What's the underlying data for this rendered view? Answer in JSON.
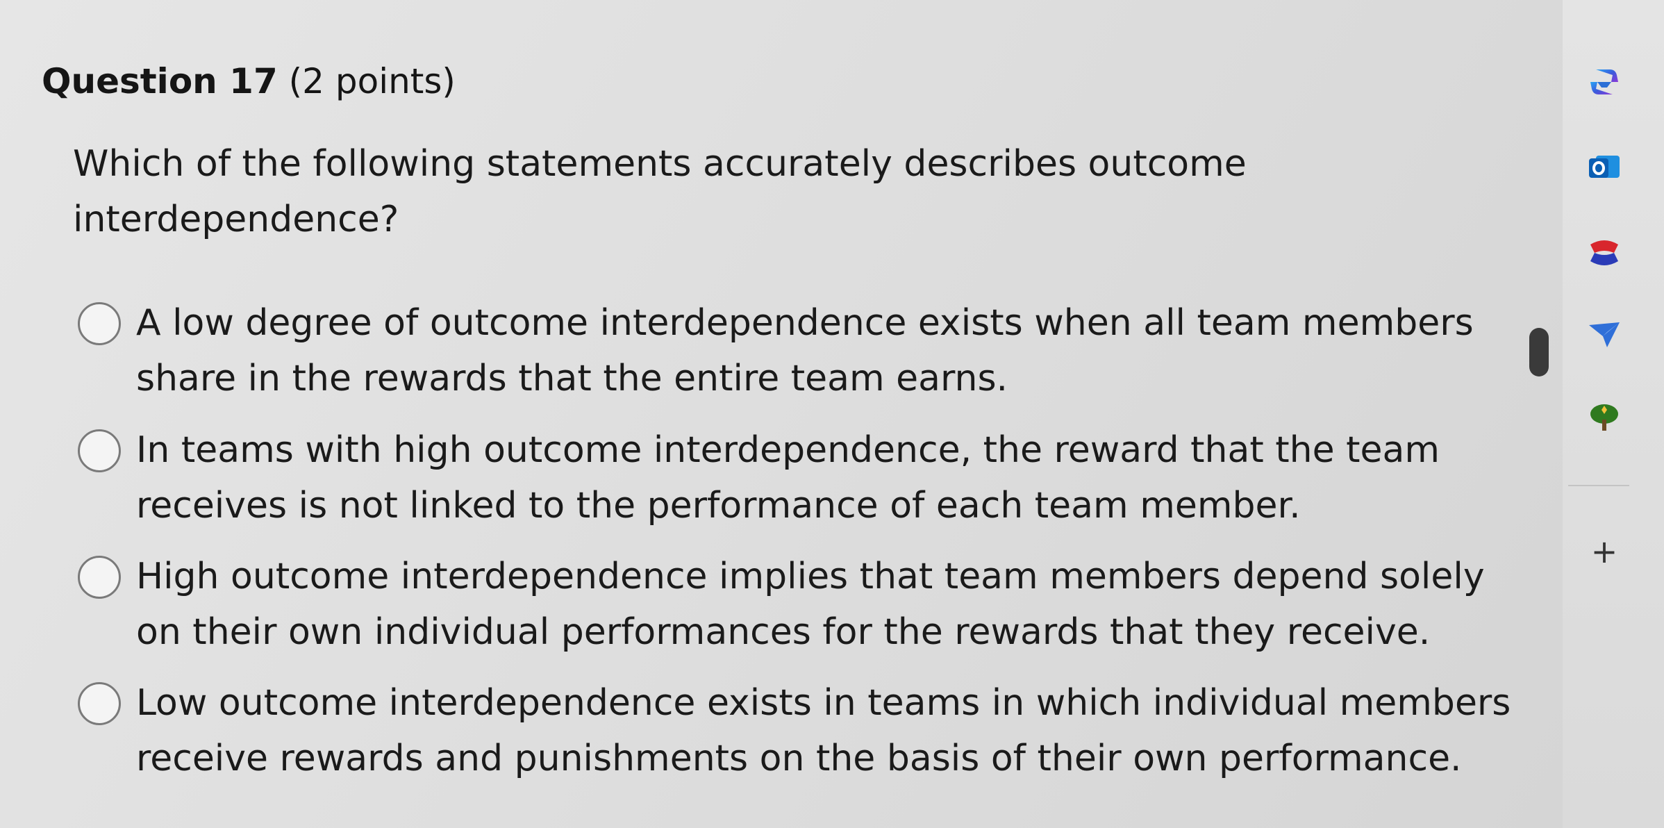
{
  "question": {
    "number_label": "Question 17",
    "points_label": "(2 points)",
    "prompt": "Which of the following statements accurately describes outcome interdependence?"
  },
  "options": [
    {
      "text": "A low degree of outcome interdependence exists when all team members share in the rewards that the entire team earns.",
      "selected": false
    },
    {
      "text": "In teams with high outcome interdependence, the reward that the team receives is not linked to the performance of each team member.",
      "selected": false
    },
    {
      "text": "High outcome interdependence implies that team members depend solely on their own individual performances for the rewards that they receive.",
      "selected": false
    },
    {
      "text": "Low outcome interdependence exists in teams in which individual members receive rewards and punishments on the basis of their own performance.",
      "selected": false
    }
  ],
  "sidebar": {
    "icons": [
      "copilot-icon",
      "outlook-icon",
      "games-icon",
      "send-icon",
      "tree-icon"
    ],
    "add_label": "+"
  }
}
